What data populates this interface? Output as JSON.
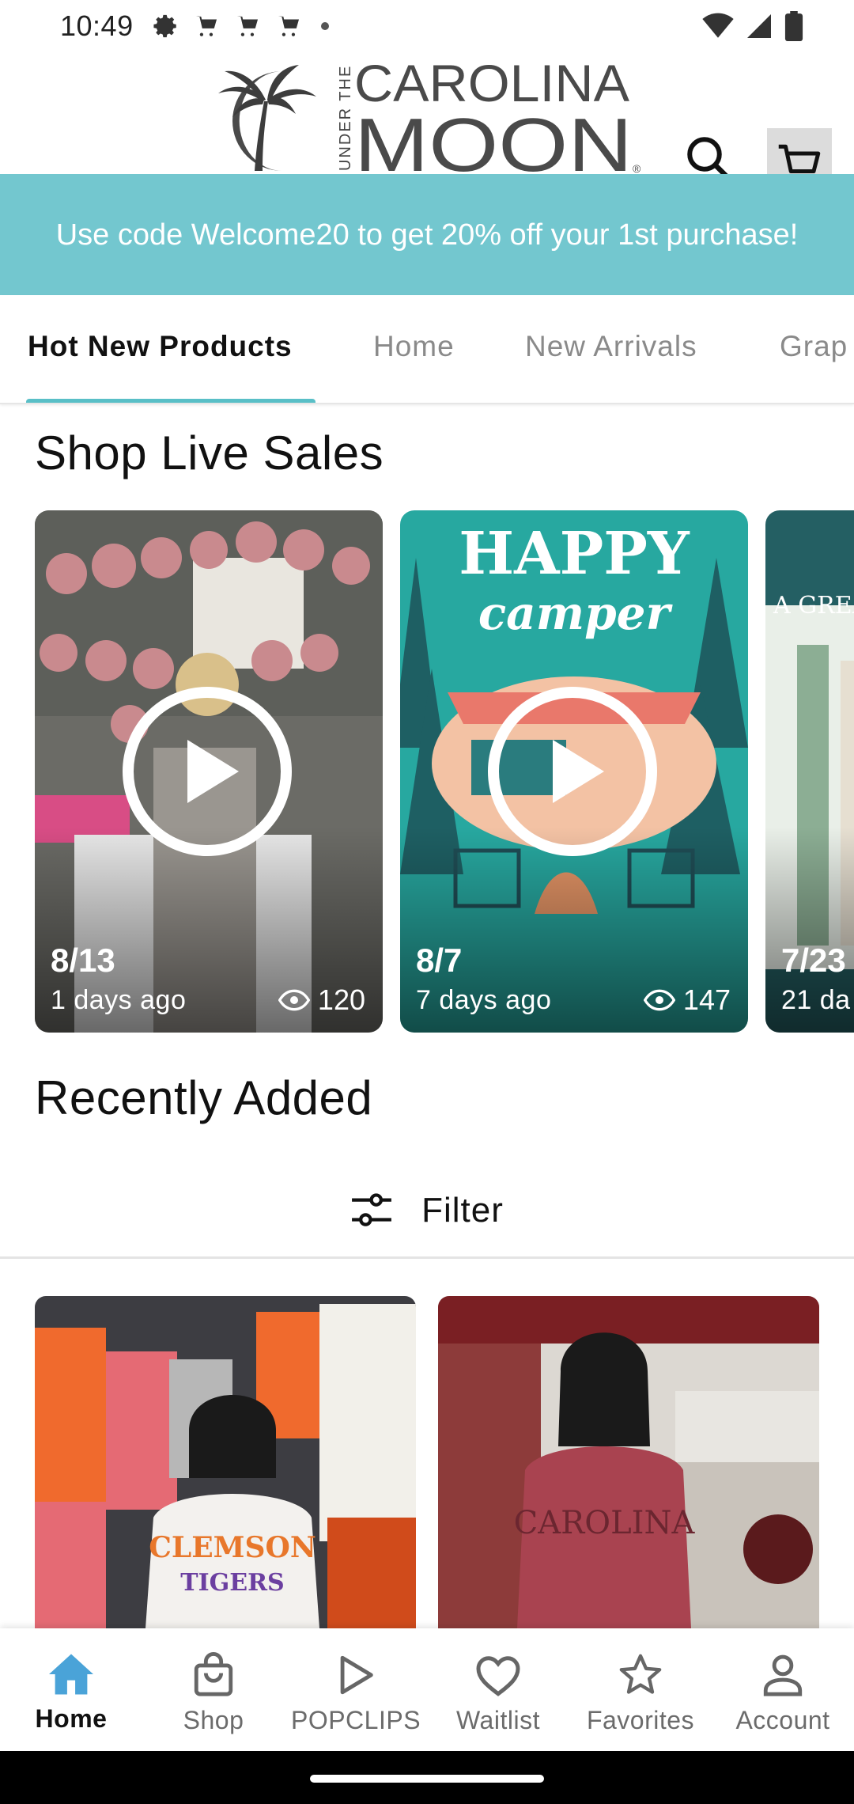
{
  "status_bar": {
    "time": "10:49",
    "left_icons": [
      "settings-icon",
      "cart-notification-icon",
      "cart-notification-icon",
      "cart-notification-icon",
      "dot-icon"
    ],
    "right_icons": [
      "wifi-icon",
      "signal-icon",
      "battery-icon"
    ]
  },
  "header": {
    "logo_text_top": "CAROLINA",
    "logo_text_bottom": "MOON",
    "logo_vertical": "UNDER THE",
    "logo_mark": "®",
    "search_icon": "search-icon",
    "cart_icon": "cart-icon"
  },
  "promo": {
    "text": "Use code Welcome20 to get 20% off your 1st purchase!",
    "color": "#73c7cf"
  },
  "tabs": [
    {
      "label": "Hot New Products",
      "active": true
    },
    {
      "label": "Home",
      "active": false
    },
    {
      "label": "New Arrivals",
      "active": false
    },
    {
      "label": "Grap",
      "active": false
    }
  ],
  "live_sales": {
    "title": "Shop Live Sales",
    "cards": [
      {
        "date": "8/13",
        "ago": "1 days ago",
        "views": "120"
      },
      {
        "date": "8/7",
        "ago": "7 days ago",
        "views": "147"
      },
      {
        "date": "7/23",
        "ago": "21 da",
        "views": ""
      }
    ]
  },
  "recently_added": {
    "title": "Recently Added",
    "filter_label": "Filter"
  },
  "bottom_nav": [
    {
      "label": "Home",
      "icon": "home-icon",
      "active": true
    },
    {
      "label": "Shop",
      "icon": "shopping-bag-icon",
      "active": false
    },
    {
      "label": "POPCLIPS",
      "icon": "play-icon",
      "active": false
    },
    {
      "label": "Waitlist",
      "icon": "heart-icon",
      "active": false
    },
    {
      "label": "Favorites",
      "icon": "star-icon",
      "active": false
    },
    {
      "label": "Account",
      "icon": "account-icon",
      "active": false
    }
  ],
  "colors": {
    "accent": "#59bfc7",
    "nav_active": "#4aa3d8"
  }
}
